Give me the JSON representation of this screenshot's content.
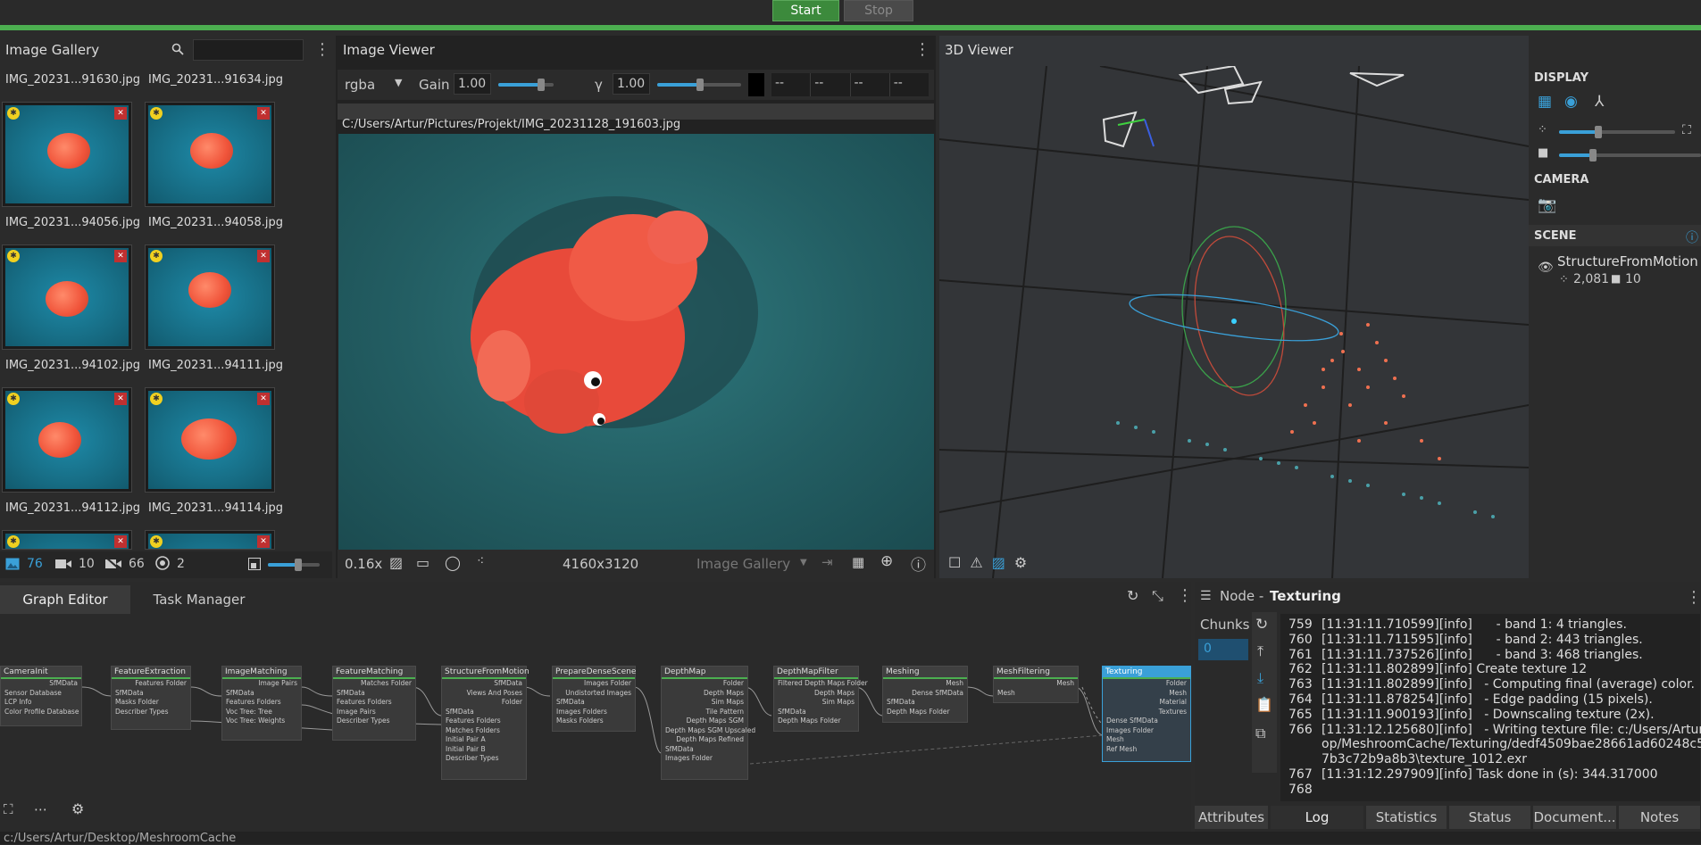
{
  "toolbar": {
    "start": "Start",
    "stop": "Stop"
  },
  "gallery": {
    "title": "Image Gallery",
    "row0": [
      "IMG_20231...91630.jpg",
      "IMG_20231...91634.jpg"
    ],
    "items": [
      "IMG_20231...94056.jpg",
      "IMG_20231...94058.jpg",
      "IMG_20231...94102.jpg",
      "IMG_20231...94111.jpg",
      "IMG_20231...94112.jpg",
      "IMG_20231...94114.jpg"
    ],
    "footer": {
      "images": "76",
      "cameras": "10",
      "no_cam": "66",
      "intrinsics": "2"
    }
  },
  "viewer": {
    "title": "Image Viewer",
    "channel": "rgba",
    "gain_label": "Gain",
    "gain": "1.00",
    "gamma_label": "γ",
    "gamma": "1.00",
    "pixels": [
      "--",
      "--",
      "--",
      "--"
    ],
    "path": "C:/Users/Artur/Pictures/Projekt/IMG_20231128_191603.jpg",
    "zoom": "0.16x",
    "resolution": "4160x3120",
    "source": "Image Gallery"
  },
  "v3d": {
    "title": "3D Viewer",
    "display": "DISPLAY",
    "camera": "CAMERA",
    "scene": "SCENE",
    "scene_item": "StructureFromMotion",
    "points": "2,081",
    "cams": "10"
  },
  "graph": {
    "tabs": [
      "Graph Editor",
      "Task Manager"
    ],
    "nodes": [
      {
        "title": "CameraInit",
        "rows": [
          "SfMData",
          "Sensor Database",
          "LCP Info",
          "Color Profile Database"
        ]
      },
      {
        "title": "FeatureExtraction",
        "rows": [
          "Features Folder",
          "SfMData",
          "Masks Folder",
          "Describer Types"
        ]
      },
      {
        "title": "ImageMatching",
        "rows": [
          "Image Pairs",
          "SfMData",
          "Features Folders",
          "Voc Tree: Tree",
          "Voc Tree: Weights"
        ]
      },
      {
        "title": "FeatureMatching",
        "rows": [
          "Matches Folder",
          "SfMData",
          "Features Folders",
          "Image Pairs",
          "Describer Types"
        ]
      },
      {
        "title": "StructureFromMotion",
        "rows": [
          "SfMData",
          "Views And Poses",
          "Folder",
          "SfMData",
          "Features Folders",
          "Matches Folders",
          "Initial Pair A",
          "Initial Pair B",
          "Describer Types"
        ]
      },
      {
        "title": "PrepareDenseScene",
        "rows": [
          "Images Folder",
          "Undistorted Images",
          "SfMData",
          "Images Folders",
          "Masks Folders"
        ]
      },
      {
        "title": "DepthMap",
        "rows": [
          "Folder",
          "Depth Maps",
          "Sim Maps",
          "Tile Pattern",
          "Depth Maps SGM",
          "Depth Maps SGM Upscaled",
          "Depth Maps Refined",
          "SfMData",
          "Images Folder"
        ]
      },
      {
        "title": "DepthMapFilter",
        "rows": [
          "Filtered Depth Maps Folder",
          "Depth Maps",
          "Sim Maps",
          "SfMData",
          "Depth Maps Folder"
        ]
      },
      {
        "title": "Meshing",
        "rows": [
          "Mesh",
          "Dense SfMData",
          "SfMData",
          "Depth Maps Folder"
        ]
      },
      {
        "title": "MeshFiltering",
        "rows": [
          "Mesh",
          "Mesh"
        ]
      },
      {
        "title": "Texturing",
        "rows": [
          "Folder",
          "Mesh",
          "Material",
          "Textures",
          "Dense SfMData",
          "Images Folder",
          "Mesh",
          "Ref Mesh"
        ]
      }
    ]
  },
  "node": {
    "title_prefix": "Node - ",
    "title": "Texturing",
    "chunks": "Chunks",
    "chunk": "0",
    "log": [
      {
        "n": "759",
        "t": "[11:31:11.710599][info]      - band 1: 4 triangles."
      },
      {
        "n": "760",
        "t": "[11:31:11.711595][info]      - band 2: 443 triangles."
      },
      {
        "n": "761",
        "t": "[11:31:11.737526][info]      - band 3: 468 triangles."
      },
      {
        "n": "762",
        "t": "[11:31:11.802899][info] Create texture 12"
      },
      {
        "n": "763",
        "t": "[11:31:11.802899][info]   - Computing final (average) color."
      },
      {
        "n": "764",
        "t": "[11:31:11.878254][info]   - Edge padding (15 pixels)."
      },
      {
        "n": "765",
        "t": "[11:31:11.900193][info]   - Downscaling texture (2x)."
      },
      {
        "n": "766",
        "t": "[11:31:12.125680][info]   - Writing texture file: c:/Users/Artur/Deskt"
      },
      {
        "n": "",
        "t": "op/MeshroomCache/Texturing/dedf4509bae28661ad60248c5c53"
      },
      {
        "n": "",
        "t": "7b3c72b9a8b3\\texture_1012.exr"
      },
      {
        "n": "767",
        "t": "[11:31:12.297909][info] Task done in (s): 344.317000"
      },
      {
        "n": "768",
        "t": ""
      }
    ],
    "tabs": [
      "Attributes",
      "Log",
      "Statistics",
      "Status",
      "Document...",
      "Notes"
    ]
  },
  "status": {
    "path": "c:/Users/Artur/Desktop/MeshroomCache"
  }
}
